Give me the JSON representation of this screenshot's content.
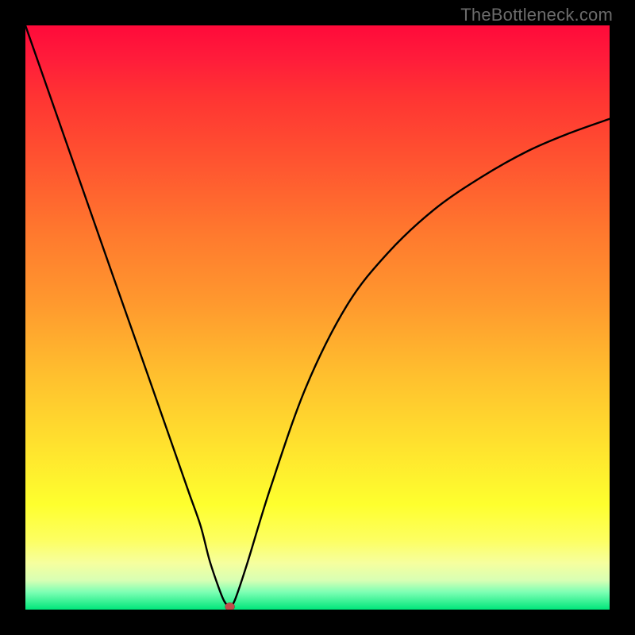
{
  "watermark": "TheBottleneck.com",
  "chart_data": {
    "type": "line",
    "title": "",
    "xlabel": "",
    "ylabel": "",
    "xlim": [
      0,
      100
    ],
    "ylim": [
      0,
      100
    ],
    "series": [
      {
        "name": "bottleneck-curve",
        "x": [
          0,
          5,
          10,
          15,
          20,
          25,
          28,
          30,
          31.5,
          33,
          34,
          34.8,
          35.2,
          36,
          38,
          42,
          48,
          55,
          62,
          70,
          78,
          86,
          93,
          100
        ],
        "y": [
          100,
          85.7,
          71.4,
          57.1,
          42.9,
          28.6,
          20.0,
          14.3,
          8.5,
          4.0,
          1.5,
          0.5,
          0.5,
          2.0,
          8.0,
          21.0,
          38.0,
          52.0,
          61.0,
          68.5,
          74.0,
          78.5,
          81.5,
          84.0
        ]
      }
    ],
    "annotations": [
      {
        "name": "minimum-marker",
        "x": 35,
        "y": 0.5,
        "shape": "ellipse",
        "color": "#c24b4b"
      }
    ],
    "background_gradient": {
      "stops": [
        {
          "pos": 0.0,
          "color": "#ff0a3a"
        },
        {
          "pos": 0.22,
          "color": "#ff5030"
        },
        {
          "pos": 0.48,
          "color": "#ff9a2e"
        },
        {
          "pos": 0.72,
          "color": "#ffe22e"
        },
        {
          "pos": 0.92,
          "color": "#f6ff9e"
        },
        {
          "pos": 1.0,
          "color": "#00e67a"
        }
      ]
    }
  }
}
